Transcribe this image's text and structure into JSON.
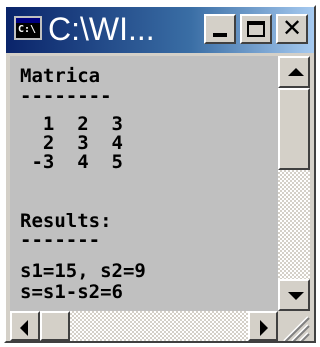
{
  "window": {
    "title": "C:\\WI...",
    "app_icon": {
      "name": "console-icon",
      "text": "C:\\"
    }
  },
  "titlebar_buttons": {
    "minimize": "minimize-icon",
    "maximize": "maximize-icon",
    "close": {
      "icon": "close-icon",
      "glyph": "✕"
    }
  },
  "console": {
    "lines": [
      "Matrica",
      "--------",
      "  1  2  3",
      "  2  3  4",
      " -3  4  5",
      "",
      "Results:",
      "-------",
      "s1=15, s2=9",
      "s=s1-s2=6"
    ]
  },
  "colors": {
    "console_bg": "#c0c0c0",
    "console_text": "#000000",
    "titlebar_start": "#0a246a",
    "titlebar_end": "#a6caf0",
    "chrome": "#d4d0c8"
  },
  "scrollbars": {
    "vertical": {
      "up": "arrow-up-icon",
      "down": "arrow-down-icon"
    },
    "horizontal": {
      "left": "arrow-left-icon",
      "right": "arrow-right-icon"
    }
  }
}
